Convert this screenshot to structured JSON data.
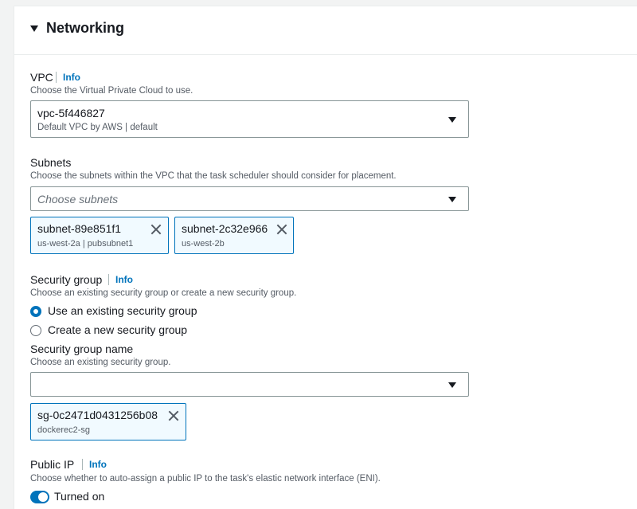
{
  "section": {
    "title": "Networking"
  },
  "vpc": {
    "label": "VPC",
    "info": "Info",
    "description": "Choose the Virtual Private Cloud to use.",
    "selected_value": "vpc-5f446827",
    "selected_sub": "Default VPC by AWS | default"
  },
  "subnets": {
    "label": "Subnets",
    "description": "Choose the subnets within the VPC that the task scheduler should consider for placement.",
    "placeholder": "Choose subnets",
    "tokens": [
      {
        "id": "subnet-89e851f1",
        "detail": "us-west-2a | pubsubnet1"
      },
      {
        "id": "subnet-2c32e966",
        "detail": "us-west-2b"
      }
    ]
  },
  "security_group": {
    "label": "Security group",
    "info": "Info",
    "description": "Choose an existing security group or create a new security group.",
    "options": [
      {
        "label": "Use an existing security group",
        "selected": true
      },
      {
        "label": "Create a new security group",
        "selected": false
      }
    ],
    "name_label": "Security group name",
    "name_description": "Choose an existing security group.",
    "name_value": "",
    "tokens": [
      {
        "id": "sg-0c2471d0431256b08",
        "detail": "dockerec2-sg"
      }
    ]
  },
  "public_ip": {
    "label": "Public IP",
    "info": "Info",
    "description": "Choose whether to auto-assign a public IP to the task's elastic network interface (ENI).",
    "toggle_label": "Turned on",
    "enabled": true
  },
  "colors": {
    "accent": "#0073bb",
    "text": "#16191f",
    "muted": "#545b64",
    "token_bg": "#f1faff"
  }
}
